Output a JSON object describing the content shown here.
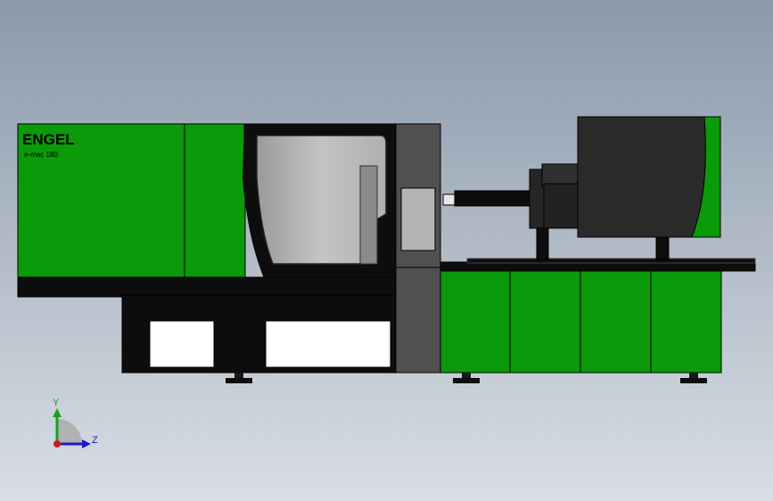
{
  "machine": {
    "brand": "ENGEL",
    "model": "e-mac 180"
  },
  "triad": {
    "y_label": "Y",
    "z_label": "Z"
  },
  "colors": {
    "background_top": "#8c9bac",
    "background_bottom": "#d7dde3",
    "machine_green": "#0a9a0a",
    "machine_black": "#0d0d0d",
    "machine_gray": "#505050",
    "window_glass": "#b4b4b4",
    "axis_y": "#1aa01a",
    "axis_z": "#1a1acc",
    "axis_origin": "#cc1a1a"
  }
}
